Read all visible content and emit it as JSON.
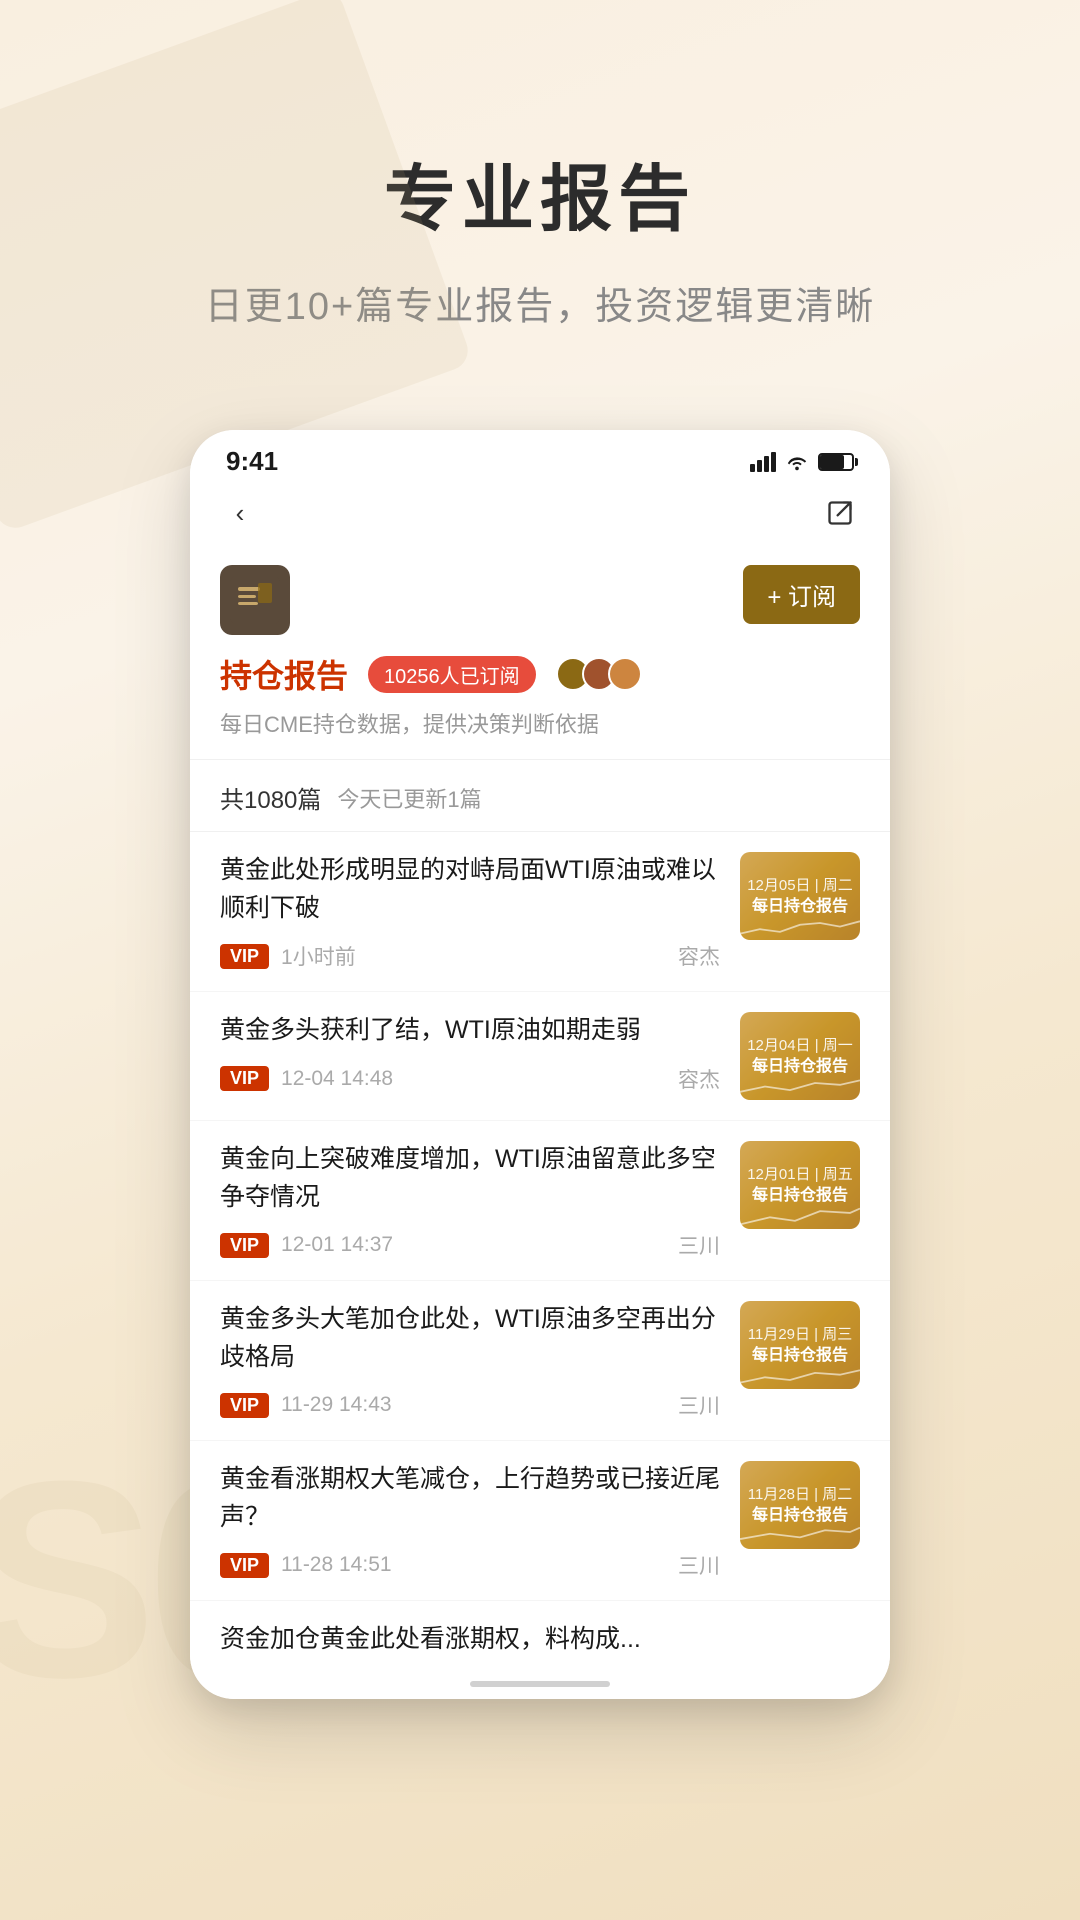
{
  "background": {
    "deco_number": "S0"
  },
  "header": {
    "title": "专业报告",
    "subtitle": "日更10+篇专业报告，投资逻辑更清晰"
  },
  "status_bar": {
    "time": "9:41",
    "signal_label": "signal",
    "wifi_label": "wifi",
    "battery_label": "battery"
  },
  "nav": {
    "back_label": "‹",
    "share_label": "⬡"
  },
  "channel": {
    "logo_alt": "持仓报告",
    "subscribe_label": "+ 订阅",
    "name": "持仓报告",
    "subscriber_count": "10256人已订阅",
    "description": "每日CME持仓数据，提供决策判断依据"
  },
  "list_header": {
    "total": "共1080篇",
    "update": "今天已更新1篇"
  },
  "articles": [
    {
      "title": "黄金此处形成明显的对峙局面WTI原油或难以顺利下破",
      "vip": "VIP",
      "time": "1小时前",
      "author": "容杰",
      "thumb_date": "12月05日 | 周二",
      "thumb_title": "每日持仓报告"
    },
    {
      "title": "黄金多头获利了结，WTI原油如期走弱",
      "vip": "VIP",
      "time": "12-04  14:48",
      "author": "容杰",
      "thumb_date": "12月04日 | 周一",
      "thumb_title": "每日持仓报告"
    },
    {
      "title": "黄金向上突破难度增加，WTI原油留意此多空争夺情况",
      "vip": "VIP",
      "time": "12-01  14:37",
      "author": "三川",
      "thumb_date": "12月01日 | 周五",
      "thumb_title": "每日持仓报告"
    },
    {
      "title": "黄金多头大笔加仓此处，WTI原油多空再出分歧格局",
      "vip": "VIP",
      "time": "11-29  14:43",
      "author": "三川",
      "thumb_date": "11月29日 | 周三",
      "thumb_title": "每日持仓报告"
    },
    {
      "title": "黄金看涨期权大笔减仓，上行趋势或已接近尾声？",
      "vip": "VIP",
      "time": "11-28  14:51",
      "author": "三川",
      "thumb_date": "11月28日 | 周二",
      "thumb_title": "每日持仓报告"
    },
    {
      "title": "资金加仓黄金此处看涨期权，料构成...",
      "vip": "",
      "time": "",
      "author": "",
      "thumb_date": "",
      "thumb_title": ""
    }
  ]
}
